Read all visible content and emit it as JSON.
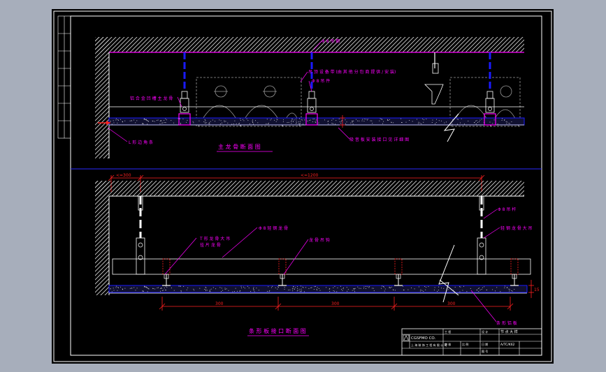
{
  "drawing": {
    "colors": {
      "background": "#000000",
      "frame": "#ffffff",
      "centerline": "#2a2aff",
      "wall": "#ffffff",
      "ceiling_line": "#ff00ff",
      "annotation": "#ff00ff",
      "dimension": "#ff2020",
      "hanger_rod": "#1a1aff",
      "keel": "#9b9b9b",
      "panel": "#1a1aff"
    },
    "top_section": {
      "title": "主 龙 骨 断 面 图",
      "notes": {
        "rod_top": "Φ 8 吊 筋",
        "equipment": "吊 顶 设 备 带 (由 其 他 分 包 商 提 供 / 安 装)",
        "hanger": "Φ 8 吊 件",
        "main_keel": "铝 合 金 凹 槽 主 龙 骨",
        "edge_trim": "L 形 边 角 条",
        "board": "吸 音 板 安 装 接 口 见 详 细 图"
      }
    },
    "bottom_section": {
      "title": "条 形 板 接 口 断 面 图",
      "dims_top": [
        "<=300",
        "<=1200"
      ],
      "dims_bottom": [
        "300",
        "300",
        "300"
      ],
      "dim_right": "15",
      "notes": {
        "hanger_rod": "Φ 8 吊 杆",
        "main_keel_right": "轻 钢 龙 骨 大 吊",
        "mid_keel": "Φ 8 轻 钢 龙 骨",
        "sub_keel_1": "T 形 龙 骨 大 吊",
        "sub_keel_2": "挂 片 龙 骨",
        "clip": "龙 骨 吊 钩",
        "strip": "条 形 铝 板"
      }
    },
    "title_block": {
      "logo_text": "CGSFMO CO.",
      "company": "上 海 装 饰 工 程 有 限 公 司",
      "drawing_name": "节 点 大 样",
      "row_labels": [
        "工 程",
        "设 计",
        "审 核",
        "比 例",
        "日 期",
        "图 号"
      ],
      "code": "A/TC/K62"
    }
  }
}
